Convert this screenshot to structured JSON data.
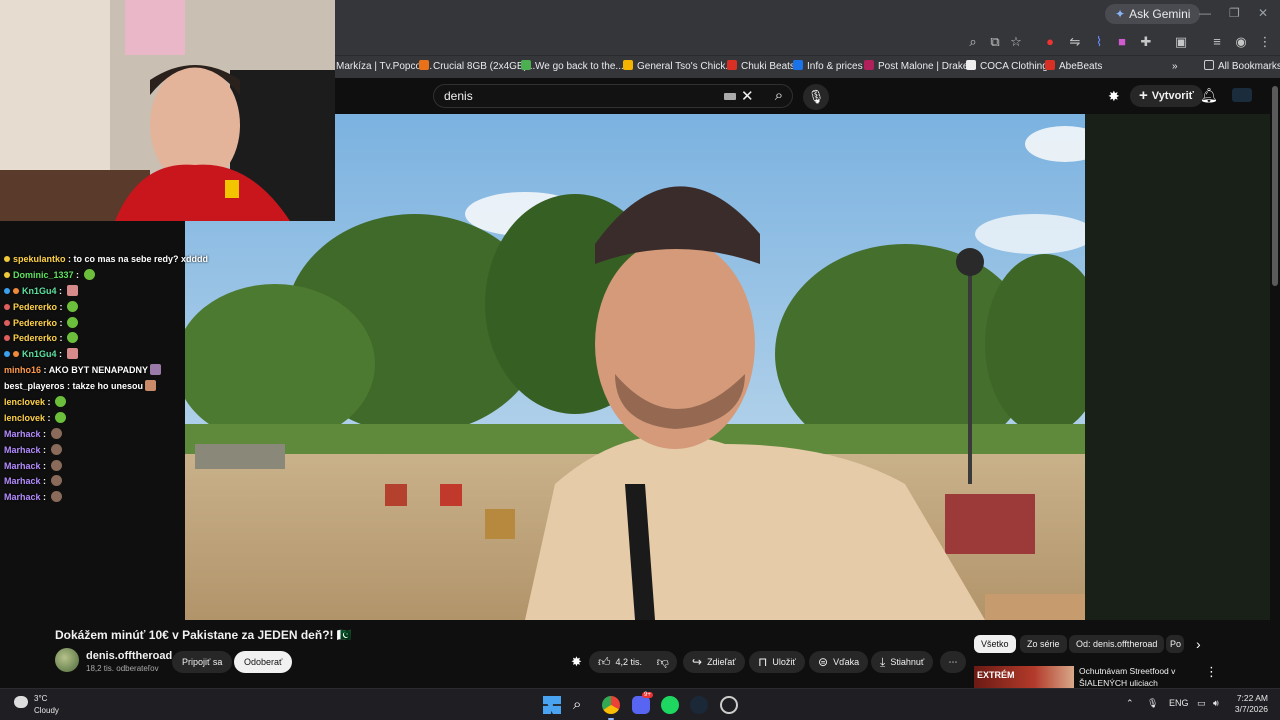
{
  "browser": {
    "gemini_label": "Ask Gemini",
    "bookmarks": [
      {
        "label": "Markíza | Tv.Popcor...",
        "color": "#ffffff"
      },
      {
        "label": "Crucial 8GB (2x4GB)...",
        "color": "#e8711a"
      },
      {
        "label": "We go back to the...",
        "color": "#4caf50"
      },
      {
        "label": "General Tso's Chick...",
        "color": "#f4b400"
      },
      {
        "label": "Chuki Beats",
        "color": "#d93025"
      },
      {
        "label": "Info & prices",
        "color": "#1a73e8"
      },
      {
        "label": "Post Malone | Drake...",
        "color": "#b0205a"
      },
      {
        "label": "COCA Clothing",
        "color": "#222222"
      },
      {
        "label": "AbeBeats",
        "color": "#d93025"
      }
    ],
    "all_bookmarks_label": "All Bookmarks"
  },
  "youtube": {
    "search_value": "denis",
    "create_label": "Vytvoriť",
    "video_title": "Dokážem minúť 10€ v Pakistane za JEDEN deň?! 🇵🇰",
    "channel_name": "denis.offtheroad",
    "subscribers": "18,2 tis. odberateľov",
    "join_label": "Pripojiť sa",
    "subscribe_label": "Odoberať",
    "likes": "4,2 tis.",
    "share_label": "Zdieľať",
    "save_label": "Uložiť",
    "thanks_label": "Vďaka",
    "download_label": "Stiahnuť",
    "chips": [
      "Všetko",
      "Zo série",
      "Od: denis.offtheroad",
      "Po"
    ],
    "next_video_thumb_text": "EXTRÉM",
    "next_video_title": "Ochutnávam Streetfood v ŠIALENÝCH uliciach Pakistan..."
  },
  "chat": [
    {
      "user": "spekulantko",
      "message": "to co mas na sebe redy? xdddd",
      "color": "#ffd24a",
      "emote": false
    },
    {
      "user": "Dominic_1337",
      "message": "",
      "color": "#5ee05e",
      "emote": true
    },
    {
      "user": "Kn1Gu4",
      "message": "",
      "color": "#5ee0a0",
      "emote": true
    },
    {
      "user": "Pedererko",
      "message": "",
      "color": "#ffd24a",
      "emote": true
    },
    {
      "user": "Pedererko",
      "message": "",
      "color": "#ffd24a",
      "emote": true
    },
    {
      "user": "Pedererko",
      "message": "",
      "color": "#ffd24a",
      "emote": true
    },
    {
      "user": "Kn1Gu4",
      "message": "",
      "color": "#5ee0a0",
      "emote": true
    },
    {
      "user": "minho16",
      "message": "AKO BYT NENAPADNY",
      "color": "#ff9a4a",
      "emote": true
    },
    {
      "user": "best_playeros",
      "message": "takze ho unesou",
      "color": "#ffffff",
      "emote": true
    },
    {
      "user": "lenclovek",
      "message": "",
      "color": "#ffd24a",
      "emote": true
    },
    {
      "user": "lenclovek",
      "message": "",
      "color": "#ffd24a",
      "emote": true
    },
    {
      "user": "Marhack",
      "message": "",
      "color": "#b38cff",
      "emote": true
    },
    {
      "user": "Marhack",
      "message": "",
      "color": "#b38cff",
      "emote": true
    },
    {
      "user": "Marhack",
      "message": "",
      "color": "#b38cff",
      "emote": true
    },
    {
      "user": "Marhack",
      "message": "",
      "color": "#b38cff",
      "emote": true
    },
    {
      "user": "Marhack",
      "message": "",
      "color": "#b38cff",
      "emote": true
    }
  ],
  "taskbar": {
    "temperature": "3°C",
    "condition": "Cloudy",
    "language": "ENG",
    "time": "7:22 AM",
    "date": "3/7/2026",
    "discord_badge": "9+"
  }
}
